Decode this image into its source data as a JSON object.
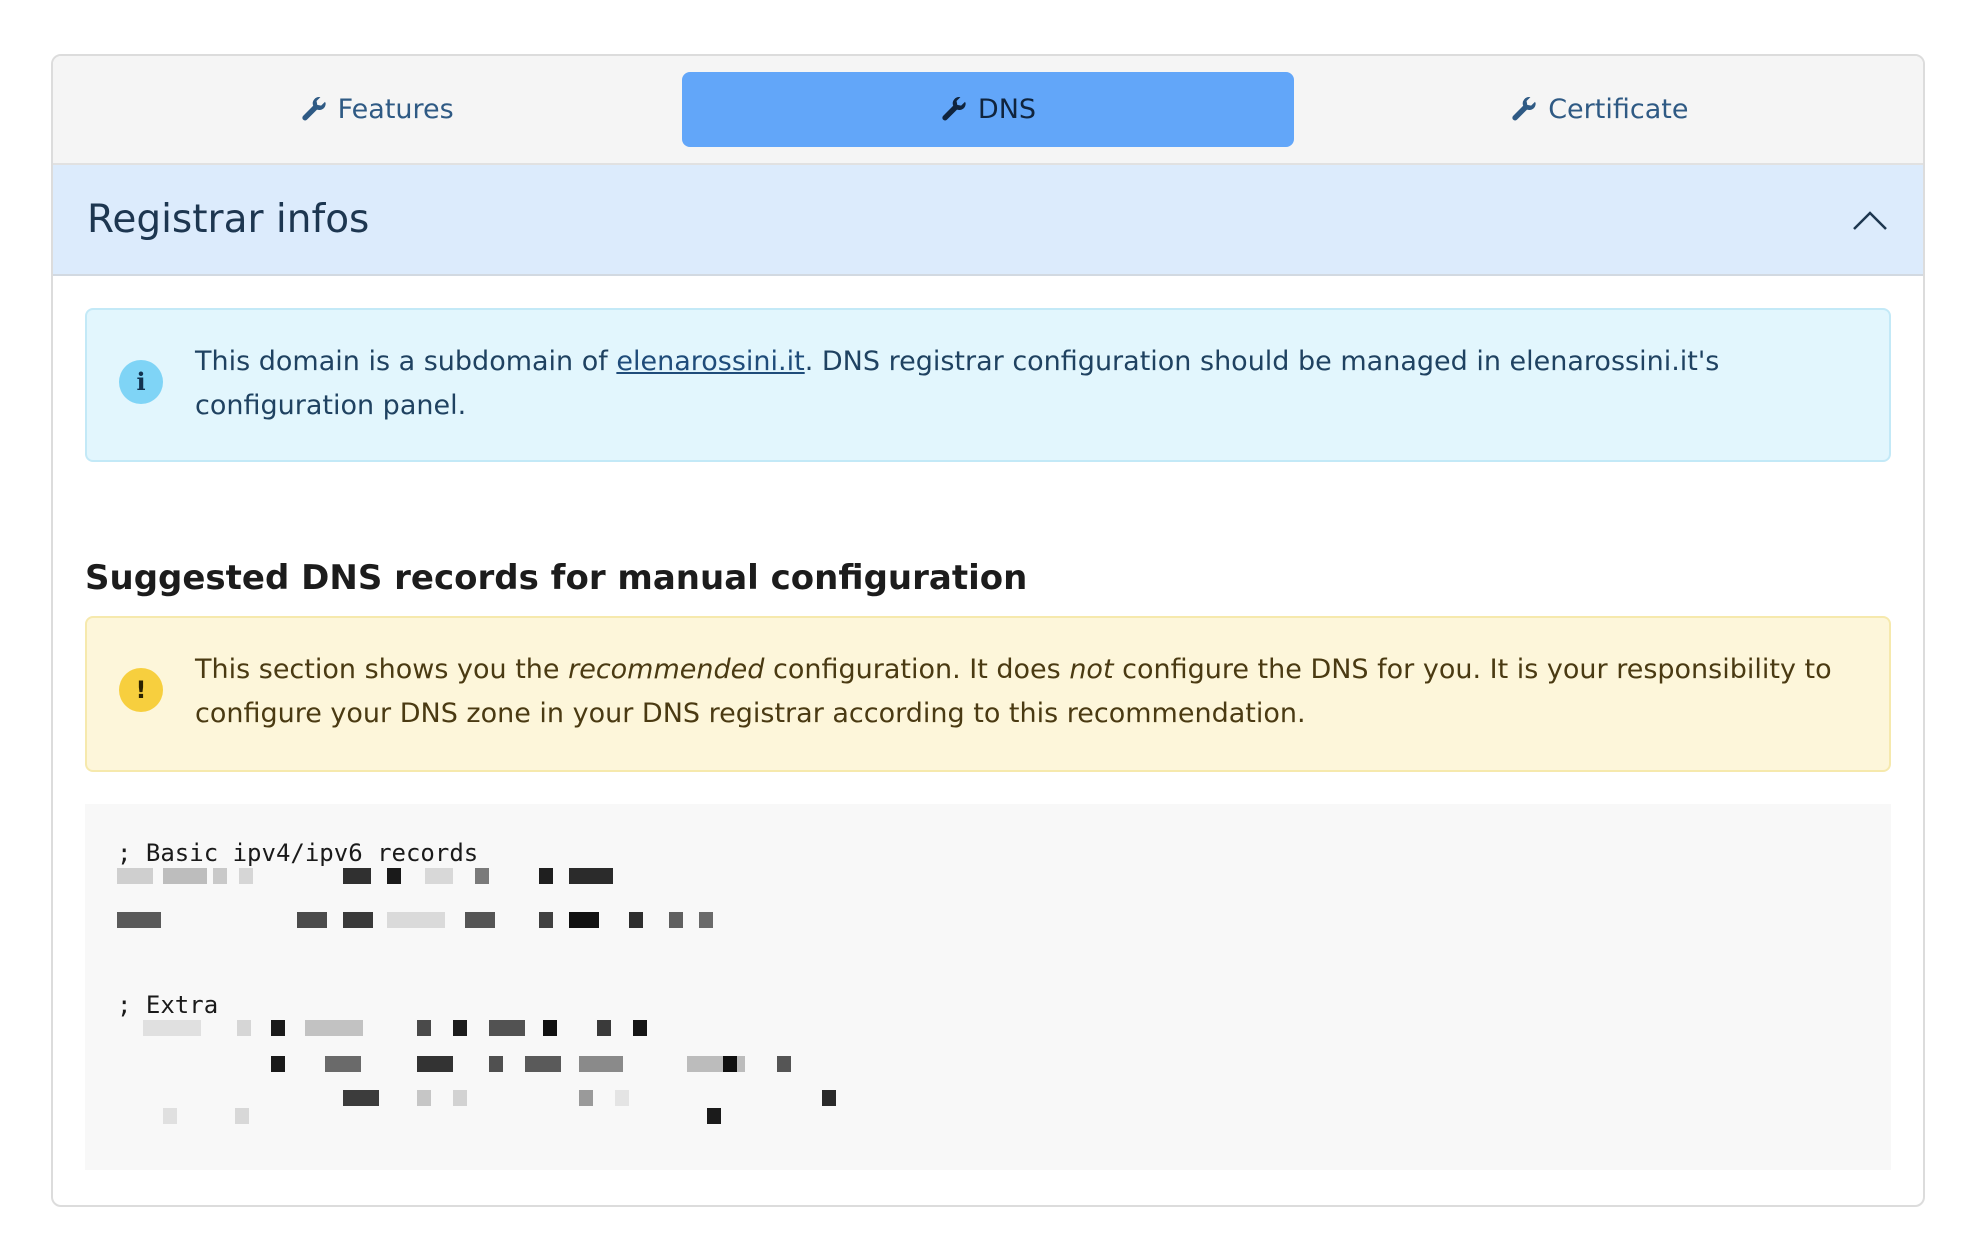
{
  "tabs": [
    {
      "label": "Features",
      "icon": "wrench-icon",
      "active": false
    },
    {
      "label": "DNS",
      "icon": "wrench-icon",
      "active": true
    },
    {
      "label": "Certificate",
      "icon": "wrench-icon",
      "active": false
    }
  ],
  "section": {
    "title": "Registrar infos",
    "toggle_icon": "chevron-up-icon"
  },
  "info_alert": {
    "icon": "info-icon",
    "text_before": "This domain is a subdomain of ",
    "link": "elenarossini.it",
    "text_after": ". DNS registrar configuration should be managed in elenarossini.it's configuration panel."
  },
  "dns_heading": "Suggested DNS records for manual configuration",
  "warning_alert": {
    "icon": "exclamation-icon",
    "t1": "This section shows you the ",
    "em1": "recommended",
    "t2": " configuration. It does ",
    "em2": "not",
    "t3": " configure the DNS for you. It is your responsibility to configure your DNS zone in your DNS registrar according to this recommendation."
  },
  "code": {
    "comment_basic": "; Basic ipv4/ipv6 records",
    "comment_extra": "; Extra"
  },
  "colors": {
    "active_tab": "#62a6f9",
    "header_bg": "#dcebfc",
    "info_bg": "#e2f6fd",
    "warn_bg": "#fdf6da"
  }
}
